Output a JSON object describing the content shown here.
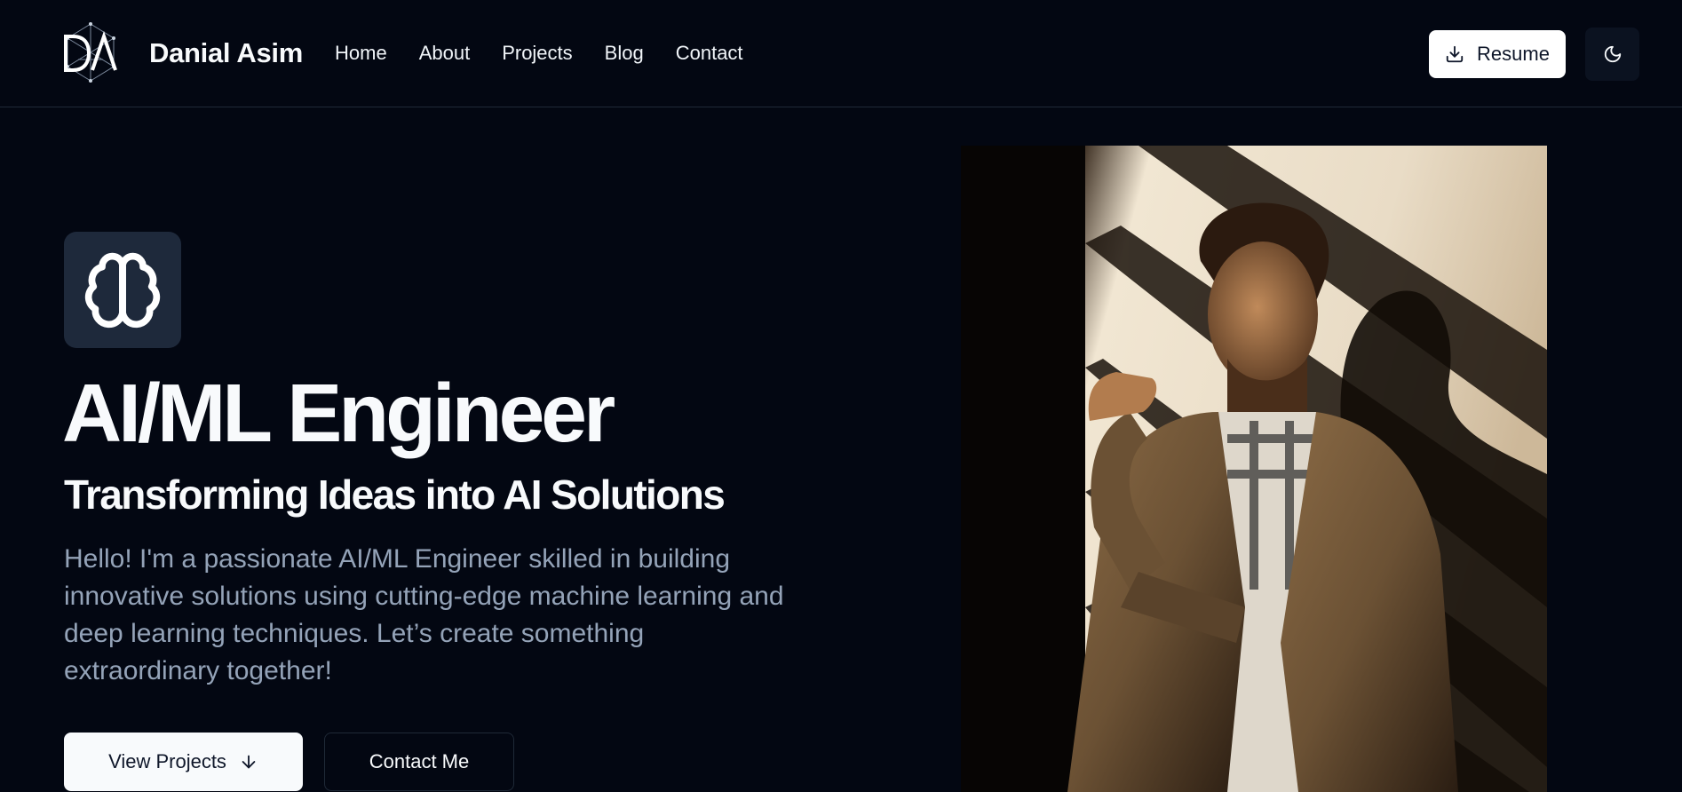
{
  "brand": {
    "logo_text": "DA",
    "name": "Danial Asim"
  },
  "nav": {
    "items": [
      {
        "label": "Home"
      },
      {
        "label": "About"
      },
      {
        "label": "Projects"
      },
      {
        "label": "Blog"
      },
      {
        "label": "Contact"
      }
    ],
    "resume_label": "Resume"
  },
  "hero": {
    "title": "AI/ML Engineer",
    "subtitle": "Transforming Ideas into AI Solutions",
    "description": "Hello! I'm a passionate AI/ML Engineer skilled in building innovative solutions using cutting-edge machine learning and deep learning techniques. Let’s create something extraordinary together!",
    "primary_button": "View Projects",
    "secondary_button": "Contact Me"
  },
  "icons": {
    "logo": "da-network-logo",
    "resume": "download-icon",
    "theme": "moon-icon",
    "hero": "brain-icon",
    "arrow": "arrow-down-icon"
  },
  "colors": {
    "background": "#030712",
    "tile": "#1e293b",
    "muted_text": "#94a3b8",
    "text": "#f8fafc"
  }
}
